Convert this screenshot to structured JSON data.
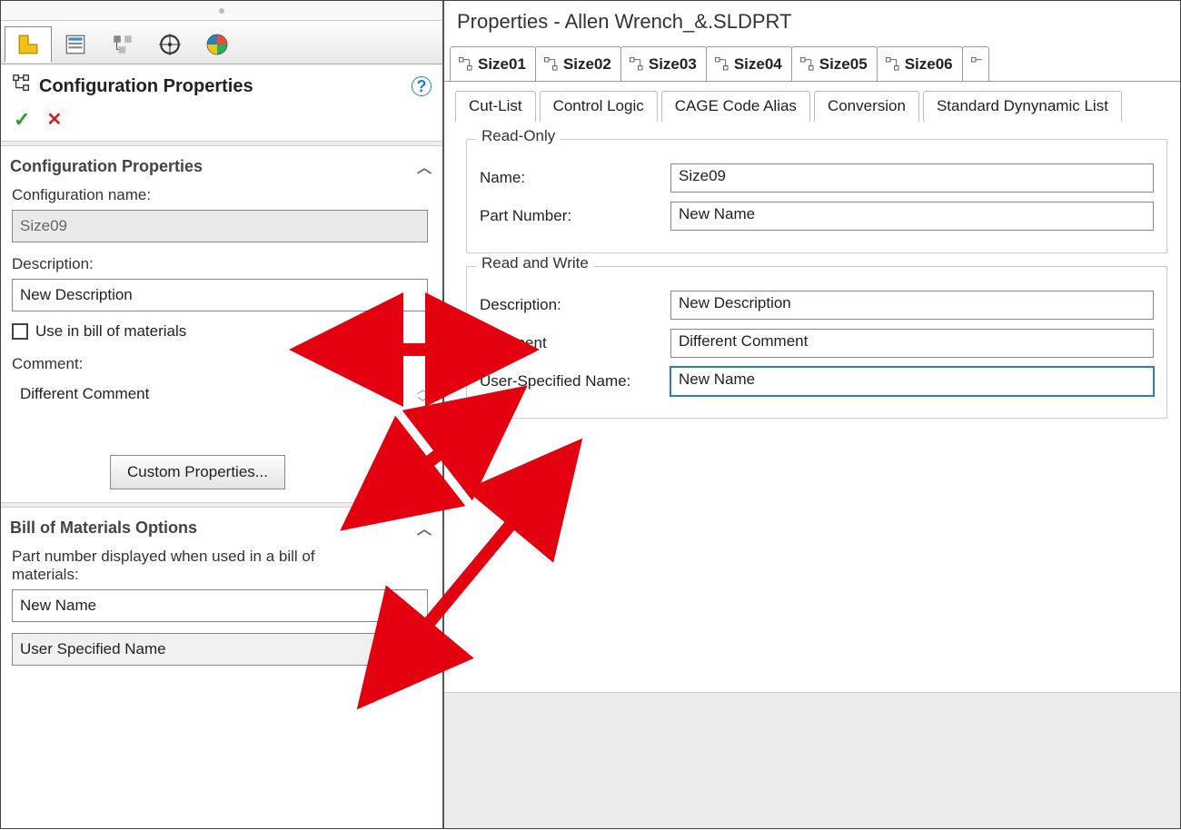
{
  "left": {
    "title": "Configuration Properties",
    "section1": "Configuration Properties",
    "name_label": "Configuration name:",
    "name_value": "Size09",
    "desc_label": "Description:",
    "desc_value": "New Description",
    "use_bom": "Use in bill of materials",
    "comment_label": "Comment:",
    "comment_value": "Different Comment",
    "custom_props_btn": "Custom Properties...",
    "section2": "Bill of Materials Options",
    "bom_label": "Part number displayed when used in a bill of materials:",
    "bom_value": "New Name",
    "bom_mode": "User Specified Name"
  },
  "right": {
    "title": "Properties - Allen Wrench_&.SLDPRT",
    "size_tabs": [
      "Size01",
      "Size02",
      "Size03",
      "Size04",
      "Size05",
      "Size06"
    ],
    "sub_tabs": [
      "Cut-List",
      "Control Logic",
      "CAGE Code Alias",
      "Conversion",
      "Standard Dynynamic List"
    ],
    "ro_legend": "Read-Only",
    "ro_name_l": "Name:",
    "ro_name_v": "Size09",
    "ro_pn_l": "Part Number:",
    "ro_pn_v": "New Name",
    "rw_legend": "Read and Write",
    "rw_desc_l": "Description:",
    "rw_desc_v": "New Description",
    "rw_comment_l": "Comment",
    "rw_comment_v": "Different Comment",
    "rw_usn_l": "User-Specified Name:",
    "rw_usn_v": "New Name"
  }
}
